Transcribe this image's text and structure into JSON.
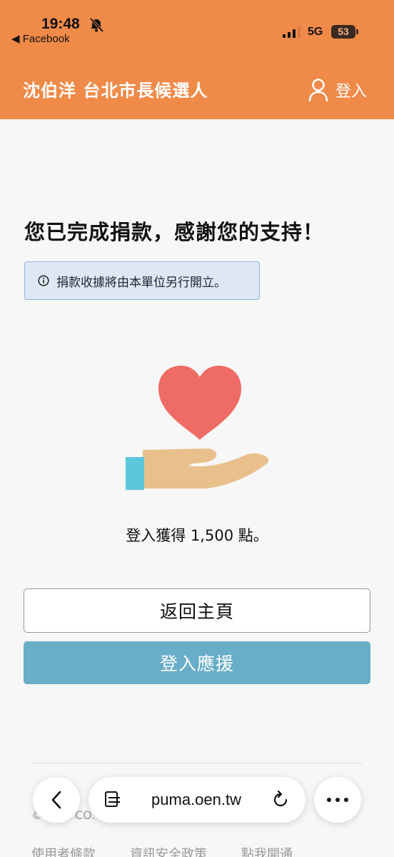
{
  "status_bar": {
    "time": "19:48",
    "back_app": "◀ Facebook",
    "network": "5G",
    "battery": "53"
  },
  "header": {
    "title": "沈伯洋 台北市長候選人",
    "login_label": "登入"
  },
  "main": {
    "heading": "您已完成捐款，感謝您的支持！",
    "notice": "捐款收據將由本單位另行開立。",
    "points_text": "登入獲得 1,500 點。",
    "home_button": "返回主頁",
    "support_button": "登入應援"
  },
  "footer": {
    "copyright": "© OEN CO.",
    "links": [
      "使用者條款",
      "資訊安全政策",
      "點我開通"
    ]
  },
  "browser": {
    "url": "puma.oen.tw"
  },
  "colors": {
    "header_bg": "#ef8a48",
    "primary_button": "#68aec9",
    "heart": "#ef6b65",
    "hand": "#e9c08c",
    "cuff": "#5cc6db"
  }
}
